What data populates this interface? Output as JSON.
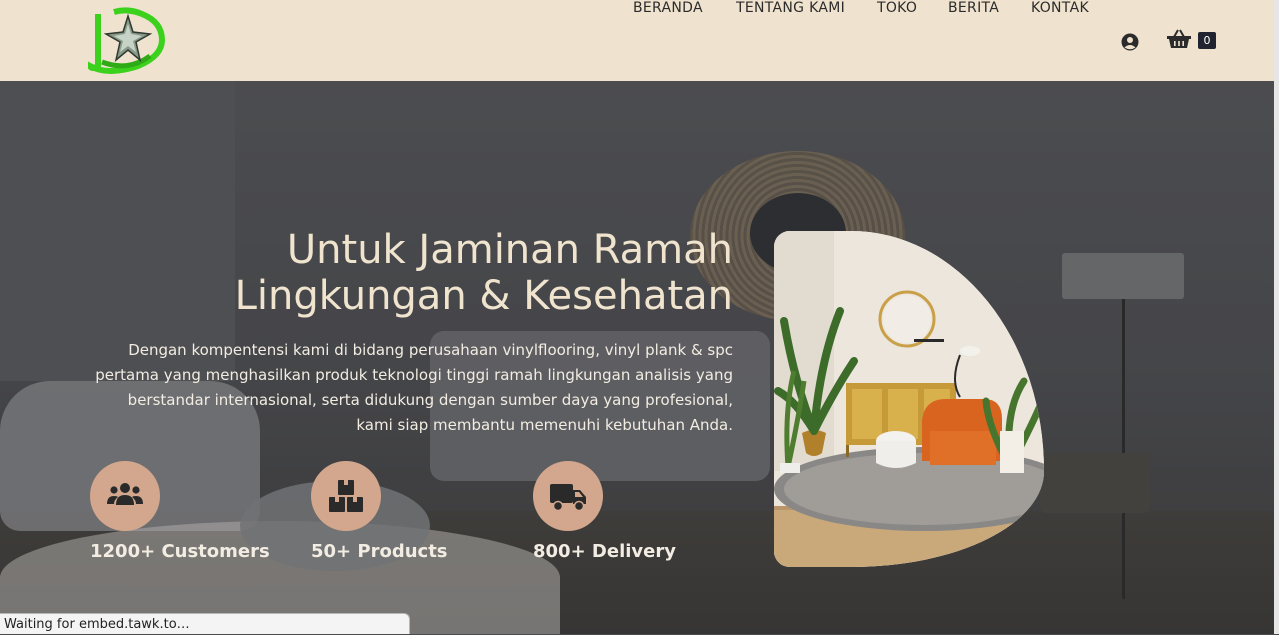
{
  "nav": {
    "items": [
      "BERANDA",
      "TENTANG KAMI",
      "TOKO",
      "BERITA",
      "KONTAK"
    ],
    "cart_count": "0",
    "icons": [
      "logo-icon",
      "user-circle-icon",
      "shopping-basket-icon"
    ]
  },
  "hero": {
    "title_line1": "Untuk Jaminan Ramah",
    "title_line2": "Lingkungan & Kesehatan",
    "description": "Dengan kompentensi kami di bidang perusahaan vinylflooring, vinyl plank & spc pertama yang menghasilkan produk teknologi tinggi ramah lingkungan analisis yang berstandar internasional, serta didukung dengan sumber daya yang profesional, kami siap membantu memenuhi kebutuhan Anda.",
    "stats": [
      {
        "label": "1200+ Customers",
        "icon": "users-icon"
      },
      {
        "label": "50+ Products",
        "icon": "boxes-icon"
      },
      {
        "label": "800+ Delivery",
        "icon": "truck-icon"
      }
    ]
  },
  "status_bar": {
    "text": "Waiting for embed.tawk.to…"
  },
  "colors": {
    "header_bg": "#efe3cf",
    "accent": "#d2a78d",
    "title": "#f0e4cf",
    "logo_green": "#3bd11c"
  }
}
